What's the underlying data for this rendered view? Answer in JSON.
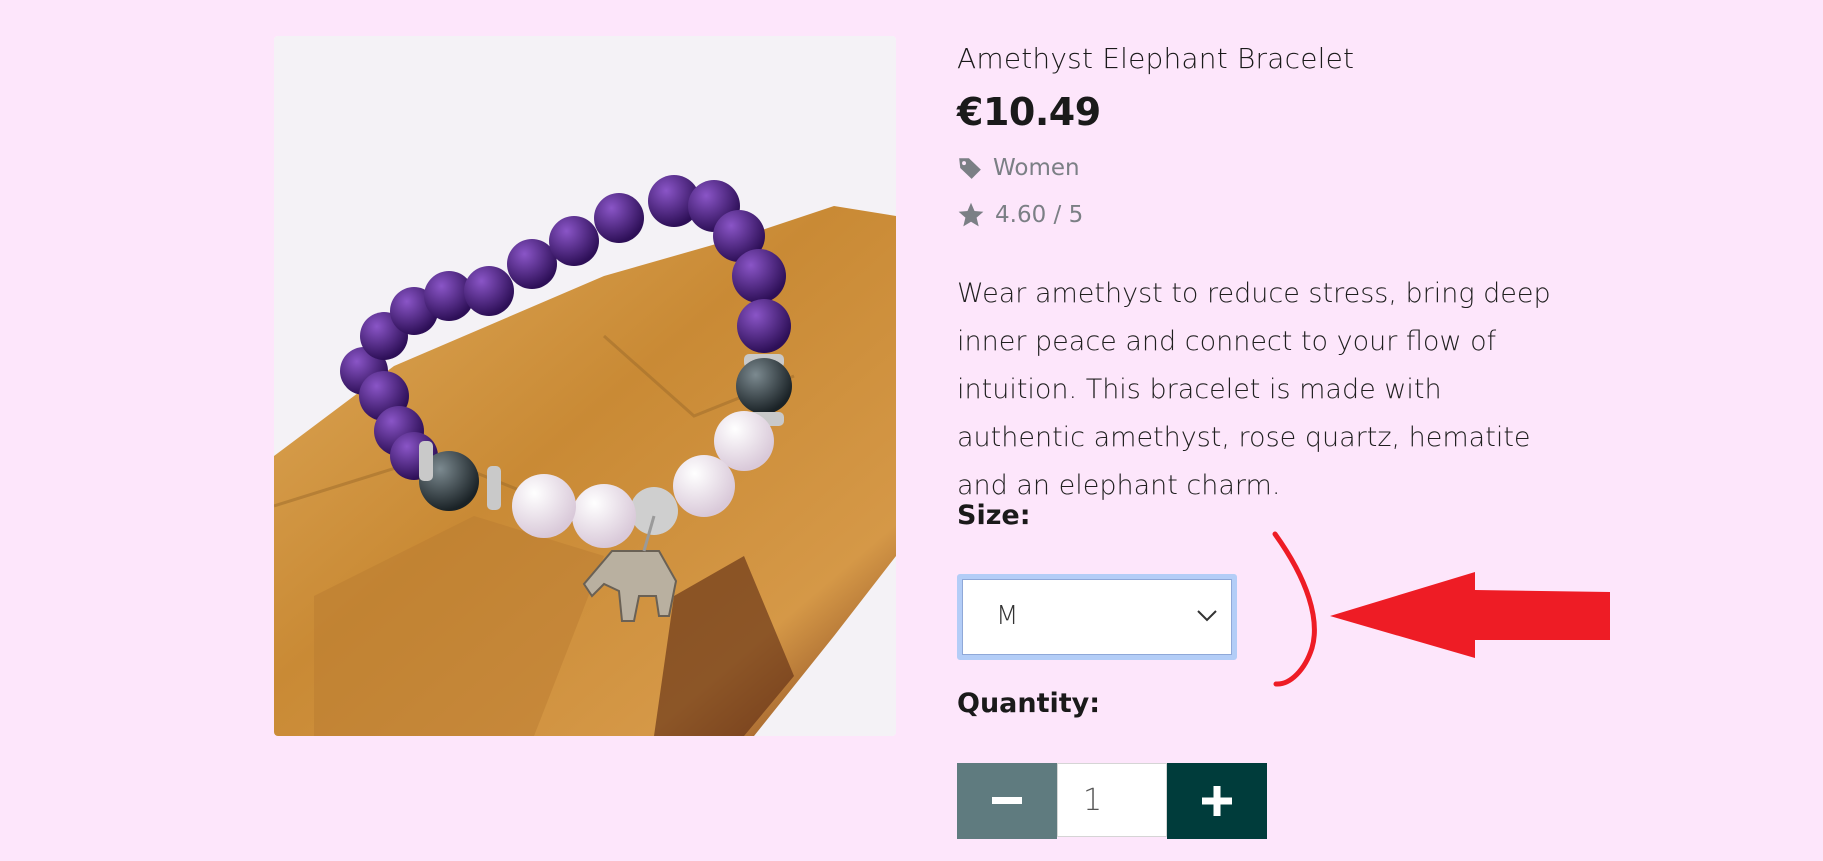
{
  "product": {
    "title": "Amethyst Elephant Bracelet",
    "price": "€10.49",
    "category": "Women",
    "rating": "4.60 / 5",
    "description": "Wear amethyst to reduce stress, bring deep inner peace and connect to your flow of intuition. This bracelet is made with authentic amethyst, rose quartz, hematite and an elephant charm."
  },
  "size": {
    "label": "Size:",
    "selected": "M"
  },
  "quantity": {
    "label": "Quantity:",
    "value": "1",
    "minus_icon": "minus-icon",
    "plus_icon": "plus-icon"
  },
  "icons": {
    "category": "tag-icon",
    "rating": "star-icon",
    "dropdown": "chevron-down-icon"
  },
  "colors": {
    "background": "#fde6fb",
    "minus_button": "#5f7b7f",
    "plus_button": "#003c3b",
    "focus_ring": "#b3cdf7",
    "annotation": "#ee1c25"
  }
}
